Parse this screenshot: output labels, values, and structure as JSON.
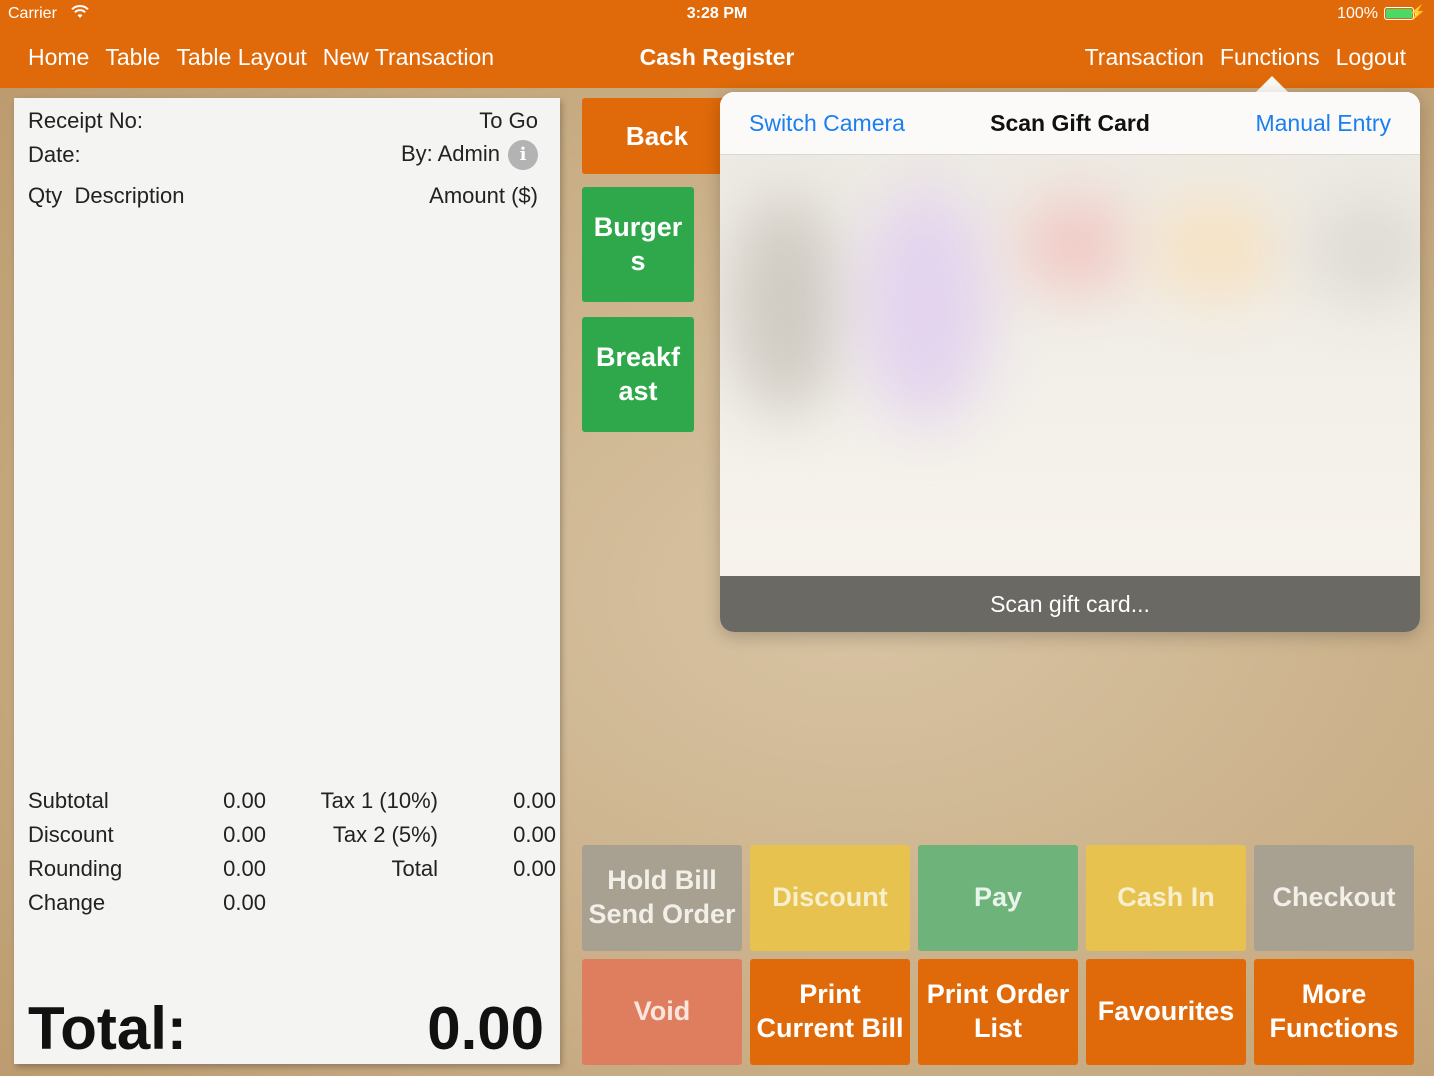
{
  "status_bar": {
    "carrier": "Carrier",
    "time": "3:28 PM",
    "battery": "100%",
    "battery_level": 1.0
  },
  "nav": {
    "left": [
      "Home",
      "Table",
      "Table Layout",
      "New Transaction"
    ],
    "title": "Cash Register",
    "right": [
      "Transaction",
      "Functions",
      "Logout"
    ]
  },
  "receipt": {
    "receipt_no_label": "Receipt No:",
    "order_type": "To Go",
    "date_label": "Date:",
    "by": "By: Admin",
    "col_qty": "Qty",
    "col_description": "Description",
    "col_amount": "Amount ($)",
    "subtotal_label": "Subtotal",
    "subtotal": "0.00",
    "discount_label": "Discount",
    "discount": "0.00",
    "rounding_label": "Rounding",
    "rounding": "0.00",
    "change_label": "Change",
    "change": "0.00",
    "tax1_label": "Tax 1 (10%)",
    "tax1": "0.00",
    "tax2_label": "Tax 2 (5%)",
    "tax2": "0.00",
    "total_small_label": "Total",
    "total_small": "0.00",
    "total_label": "Total:",
    "total": "0.00"
  },
  "categories": {
    "back": "Back",
    "burgers": "Burgers",
    "breakfast": "Breakfast"
  },
  "actions": {
    "hold_bill": "Hold Bill",
    "send_order": "Send Order",
    "discount": "Discount",
    "pay": "Pay",
    "cash_in": "Cash In",
    "checkout": "Checkout",
    "void": "Void",
    "print_current_bill": "Print Current Bill",
    "print_order_list": "Print Order List",
    "favourites": "Favourites",
    "more_functions": "More Functions"
  },
  "scan_popover": {
    "switch_camera": "Switch Camera",
    "title": "Scan Gift Card",
    "manual_entry": "Manual Entry",
    "status": "Scan gift card..."
  },
  "colors": {
    "brand_orange": "#e06a0a",
    "category_green": "#2ea84a",
    "link_blue": "#1a7ff0"
  }
}
